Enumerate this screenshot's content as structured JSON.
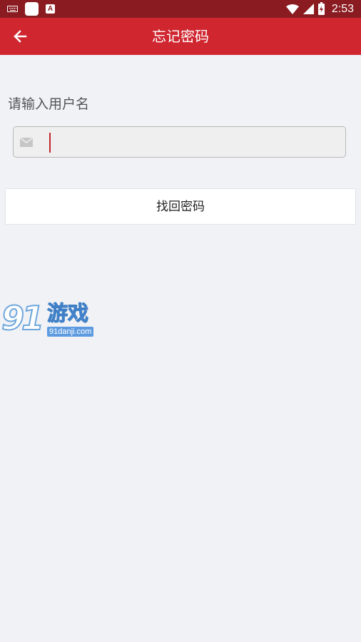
{
  "status_bar": {
    "time": "2:53",
    "icons": [
      "keyboard-icon",
      "notification-square-icon",
      "a-badge-icon",
      "wifi-icon",
      "signal-icon",
      "battery-charging-icon"
    ],
    "background": "#8a1c21"
  },
  "app_bar": {
    "title": "忘记密码",
    "back_icon": "arrow-left-icon",
    "background": "#d0262f"
  },
  "form": {
    "label": "请输入用户名",
    "username_input": {
      "value": "",
      "placeholder": "",
      "icon": "mail-icon"
    },
    "submit_label": "找回密码"
  },
  "watermark": {
    "number": "91",
    "text": "游戏",
    "url": "91danji.com",
    "color": "#5d9be0"
  }
}
